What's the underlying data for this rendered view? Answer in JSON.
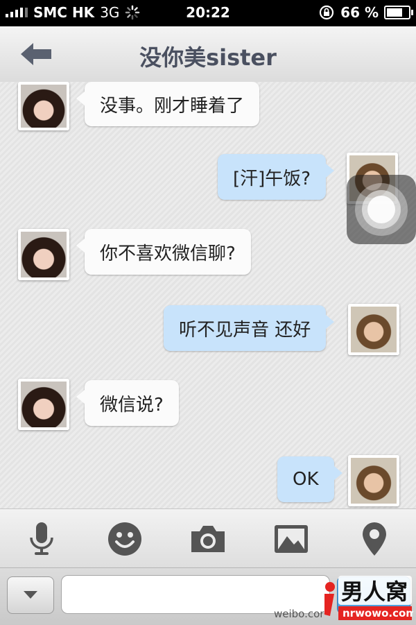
{
  "status_bar": {
    "carrier": "SMC HK",
    "network": "3G",
    "time": "20:22",
    "battery": "66 %"
  },
  "nav": {
    "title": "没你美sister"
  },
  "messages": [
    {
      "side": "in",
      "text": "没事。刚才睡着了"
    },
    {
      "side": "out",
      "text": "[汗]午饭?"
    },
    {
      "side": "in",
      "text": "你不喜欢微信聊?"
    },
    {
      "side": "out",
      "text": "听不见声音 还好"
    },
    {
      "side": "in",
      "text": "微信说?"
    },
    {
      "side": "out",
      "text": "OK"
    }
  ],
  "toolbar": {
    "items": [
      "microphone-icon",
      "emoji-icon",
      "camera-icon",
      "photo-icon",
      "location-icon"
    ]
  },
  "input": {
    "value": "",
    "placeholder": ""
  },
  "watermark": {
    "weibo": "weibo.cor",
    "logo_text": "男人窝",
    "logo_url": "nrwowo.com"
  },
  "colors": {
    "incoming_bubble": "#fbfbfb",
    "outgoing_bubble": "#c8e3fb",
    "title": "#4a5060",
    "icon": "#555555"
  }
}
